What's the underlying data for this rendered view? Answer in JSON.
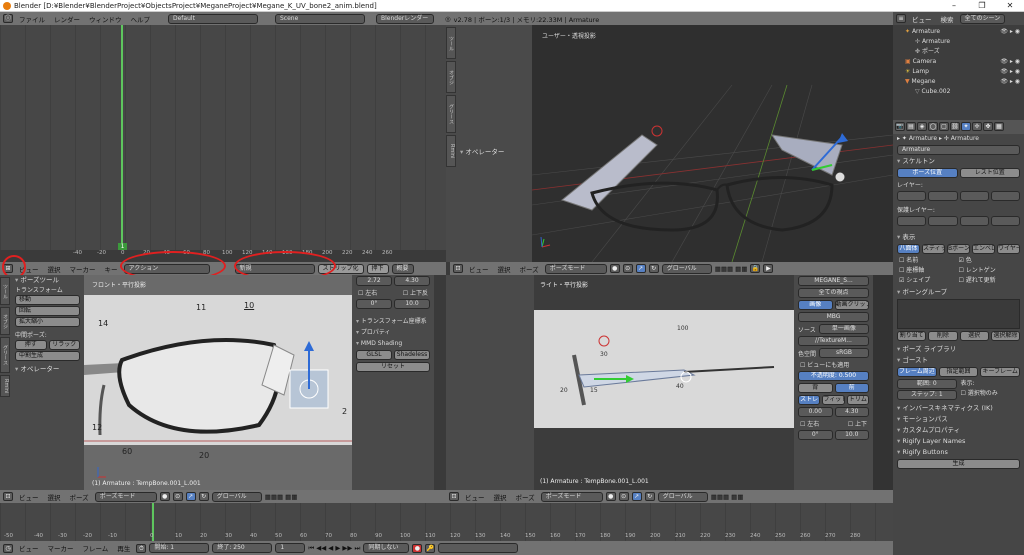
{
  "window": {
    "title": "Blender [D:¥Blender¥BlenderProject¥ObjectsProject¥MeganeProject¥Megane_K_UV_bone2_anim.blend]",
    "min": "–",
    "max": "❐",
    "close": "✕"
  },
  "topbar": {
    "menu": [
      "ファイル",
      "レンダー",
      "ウィンドウ",
      "ヘルプ"
    ],
    "layout": "Default",
    "scene": "Scene",
    "engine": "Blenderレンダー",
    "info": "v2.78 | ボーン:1/3 | メモリ:22.33M | Armature"
  },
  "outliner": {
    "view": "ビュー",
    "search": "検索",
    "scenes": "全てのシーン",
    "items": [
      "Armature",
      "Armature",
      "ポーズ",
      "Camera",
      "Lamp",
      "Megane",
      "Cube.002"
    ]
  },
  "timeline_top": {
    "frame_marker": "1",
    "ticks": [
      "-40",
      "-20",
      "0",
      "20",
      "40",
      "60",
      "80",
      "100",
      "120",
      "140",
      "160",
      "180",
      "200",
      "220",
      "240",
      "260"
    ]
  },
  "dope_header": {
    "items": [
      "ビュー",
      "選択",
      "マーカー",
      "キー"
    ],
    "mode": "アクション",
    "new": "新規",
    "stash": "ストリップ化",
    "push": "押下",
    "summary": "概要"
  },
  "viewport_top_right": {
    "label": "ユーザー・透視投影",
    "tools": [
      "ツール",
      "オブジ",
      "グリース",
      "Rmini"
    ],
    "operator": "オペレーター"
  },
  "left_tools": {
    "pose_tools": "ポーズツール",
    "transform": "トランスフォーム",
    "move": "移動",
    "rotate": "回転",
    "scale": "拡大縮小",
    "in_between": "中間ポーズ:",
    "push": "押す",
    "relax": "リラック",
    "breakdown": "中割生成",
    "operator": "オペレーター"
  },
  "viewport_front": {
    "label": "フロント・平行投影",
    "status": "(1) Armature : TempBone.001_L.001",
    "labels": [
      "11",
      "10",
      "14",
      "12",
      "60",
      "20",
      "2"
    ]
  },
  "npanel": {
    "v1": "2.72",
    "v2": "4.30",
    "left": "左右",
    "up": "上下反",
    "v3": "0°",
    "v4": "10.0",
    "transform_locks": "トランスフォーム座標系",
    "properties": "プロパティ",
    "mmd": "MMD Shading",
    "glsl": "GLSL",
    "shadeless": "Shadeless",
    "reset": "リセット"
  },
  "viewport_right": {
    "label": "ライト・平行投影",
    "status": "(1) Armature : TempBone.001_L.001",
    "labels": [
      "100",
      "30",
      "20",
      "15",
      "40"
    ]
  },
  "image_panel": {
    "name": "MEGANE_S...",
    "mode": "全ての視点",
    "image": "画像",
    "movie": "動画クリップ",
    "mbg": "MBG",
    "source": "ソース",
    "single": "単一画像",
    "path": "//TextureM...",
    "colorspace": "色空間",
    "srgb": "sRGB",
    "view_as_render": "ビューにも適用",
    "opacity_label": "不透明度:",
    "opacity": "0.500",
    "back": "背",
    "front": "前",
    "stretch": "ストレ",
    "fit": "フィット",
    "crop": "トリム",
    "x": "0.00",
    "y": "4.30",
    "left": "左右",
    "up": "上下",
    "rot": "0°",
    "size": "10.0"
  },
  "properties": {
    "armature": "Armature",
    "skeleton": "スケルトン",
    "pose_position": "ポーズ位置",
    "rest_position": "レスト位置",
    "layers": "レイヤー:",
    "protected_layers": "保護レイヤー:",
    "display": "表示",
    "octahedral": "八面体",
    "stick": "スティック",
    "bbone": "Bボーン",
    "envelope": "エンベロ",
    "wire": "ワイヤー",
    "names": "名前",
    "colors": "色",
    "axes": "座標軸",
    "xray": "レントゲン",
    "shapes": "シェイプ",
    "delay": "遅れて更新",
    "bone_groups": "ボーングループ",
    "assign": "割り当て",
    "remove": "削除",
    "select": "選択",
    "deselect": "選択解除",
    "pose_library": "ポーズ ライブラリ",
    "ghost": "ゴースト",
    "around_frame": "フレーム周辺",
    "in_range": "指定範囲",
    "keyframes": "キーフレーム",
    "range": "範囲",
    "range_v": "0",
    "step": "ステップ",
    "step_v": "1",
    "display_label": "表示:",
    "selected_only": "選択物のみ",
    "ik": "インバースキネマティクス (IK)",
    "motion_paths": "モーションパス",
    "custom_props": "カスタムプロパティ",
    "rigify_layers": "Rigify Layer Names",
    "rigify_buttons": "Rigify Buttons",
    "generate": "生成"
  },
  "viewport_headers": {
    "view": "ビュー",
    "select": "選択",
    "pose": "ポーズ",
    "mode": "ポーズモード",
    "global": "グローバル"
  },
  "timeline_bottom": {
    "items": [
      "ビュー",
      "マーカー",
      "フレーム",
      "再生"
    ],
    "start_label": "開始:",
    "start": "1",
    "end_label": "終了:",
    "end": "250",
    "current": "1",
    "sync": "同期しない",
    "ticks": [
      "-50",
      "-40",
      "-30",
      "-20",
      "-10",
      "0",
      "10",
      "20",
      "30",
      "40",
      "50",
      "60",
      "70",
      "80",
      "90",
      "100",
      "110",
      "120",
      "130",
      "140",
      "150",
      "160",
      "170",
      "180",
      "190",
      "200",
      "210",
      "220",
      "230",
      "240",
      "250",
      "260",
      "270",
      "280"
    ]
  }
}
